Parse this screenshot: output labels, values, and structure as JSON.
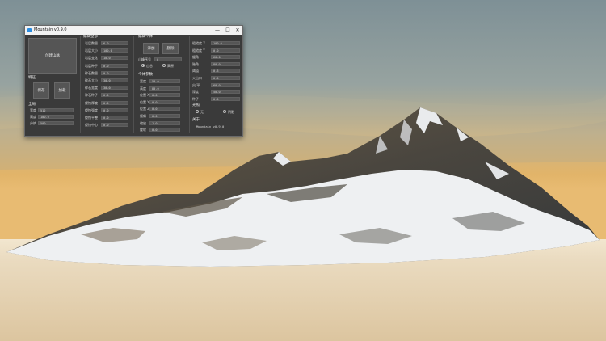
{
  "window": {
    "title": "Mountain v0.9.0",
    "minimize": "—",
    "maximize": "☐",
    "close": "✕"
  },
  "panel_create": {
    "create_button": "创建山脉"
  },
  "panel_features": {
    "header": "特征",
    "save_button": "保存",
    "load_button": "加载"
  },
  "panel_global": {
    "header": "全局",
    "fields": [
      {
        "label": "宽度",
        "value": "512"
      },
      {
        "label": "高度",
        "value": "100.0"
      },
      {
        "label": "分辨",
        "value": "500"
      }
    ]
  },
  "panel_edit_all": {
    "header": "编辑全部",
    "fields": [
      {
        "label": "岩层数量",
        "value": "6.0"
      },
      {
        "label": "岩层大小",
        "value": "100.0"
      },
      {
        "label": "岩层变化",
        "value": "10.0"
      },
      {
        "label": "岩层种子",
        "value": "0.0"
      },
      {
        "label": "碎石数量",
        "value": "0.0"
      },
      {
        "label": "碎石大小",
        "value": "30.0"
      },
      {
        "label": "碎石宽度",
        "value": "30.0"
      },
      {
        "label": "碎石种子",
        "value": "0.0"
      },
      {
        "label": "侵蚀厚度",
        "value": "0.0"
      },
      {
        "label": "侵蚀强度",
        "value": "0.0"
      },
      {
        "label": "侵蚀平整",
        "value": "0.0"
      },
      {
        "label": "侵蚀中心",
        "value": "0.0"
      }
    ]
  },
  "panel_edit_single": {
    "header": "编辑个体",
    "add_button": "添加",
    "delete_button": "删除",
    "seed_label": "山峰序号",
    "seed_value": "0",
    "radio_options": [
      "山谷",
      "高原"
    ],
    "sub_header": "个体参数",
    "fields": [
      {
        "label": "宽度",
        "value": "50.0"
      },
      {
        "label": "高度",
        "value": "80.0"
      },
      {
        "label": "位置 X",
        "value": "0.0"
      },
      {
        "label": "位置 Y",
        "value": "0.0"
      },
      {
        "label": "位置 Z",
        "value": "0.0"
      },
      {
        "label": "倾斜",
        "value": "0.0"
      },
      {
        "label": "缩放",
        "value": "1.0"
      },
      {
        "label": "旋转",
        "value": "0.0"
      }
    ]
  },
  "panel_right": {
    "fields": [
      {
        "label": "粗糙度 X",
        "value": "100.0"
      },
      {
        "label": "粗糙度 Y",
        "value": "0.0"
      },
      {
        "label": "缓角",
        "value": "60.0"
      },
      {
        "label": "陡角",
        "value": "80.0"
      },
      {
        "label": "阈值",
        "value": "0.3"
      },
      {
        "label": "火山口",
        "value": "0.0"
      },
      {
        "label": "尖/平",
        "value": "60.0"
      },
      {
        "label": "深度",
        "value": "50.0"
      },
      {
        "label": "种子",
        "value": "0.0"
      }
    ],
    "lighting_header": "光照",
    "radio_options": [
      "无",
      "阴影"
    ],
    "about_header": "关于",
    "version_text": "Mountain v0.9.0"
  },
  "colors": {
    "window_bg": "#3a3a3a",
    "field_bg": "#555555",
    "titlebar_bg": "#f2f2f2",
    "accent": "#2b8de0"
  }
}
